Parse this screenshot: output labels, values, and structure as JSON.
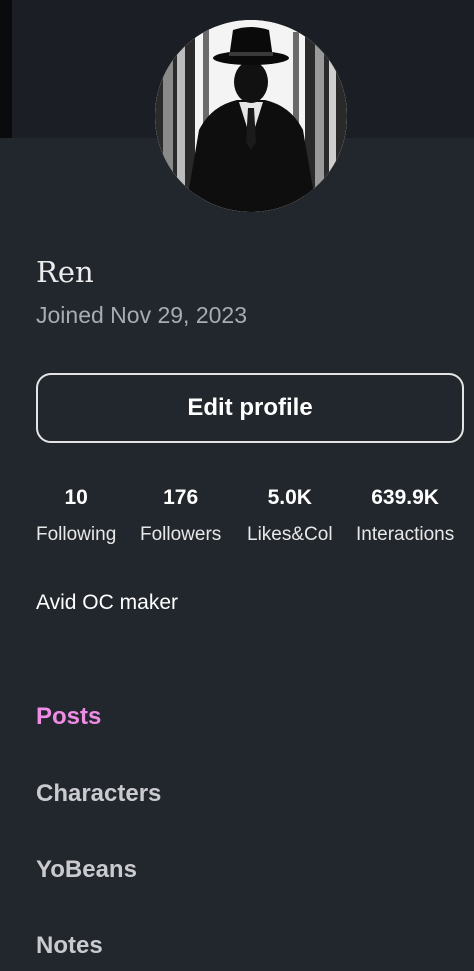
{
  "profile": {
    "name": "Ren",
    "joined": "Joined Nov 29, 2023",
    "edit_label": "Edit profile",
    "bio": "Avid OC maker"
  },
  "stats": [
    {
      "value": "10",
      "label": "Following"
    },
    {
      "value": "176",
      "label": "Followers"
    },
    {
      "value": "5.0K",
      "label": "Likes&Col"
    },
    {
      "value": "639.9K",
      "label": "Interactions"
    }
  ],
  "nav": {
    "items": [
      {
        "label": "Posts",
        "active": true
      },
      {
        "label": "Characters",
        "active": false
      },
      {
        "label": "YoBeans",
        "active": false
      },
      {
        "label": "Notes",
        "active": false
      }
    ]
  },
  "colors": {
    "background": "#22262d",
    "accent": "#ef8ce6",
    "muted_text": "#a7abb2"
  }
}
